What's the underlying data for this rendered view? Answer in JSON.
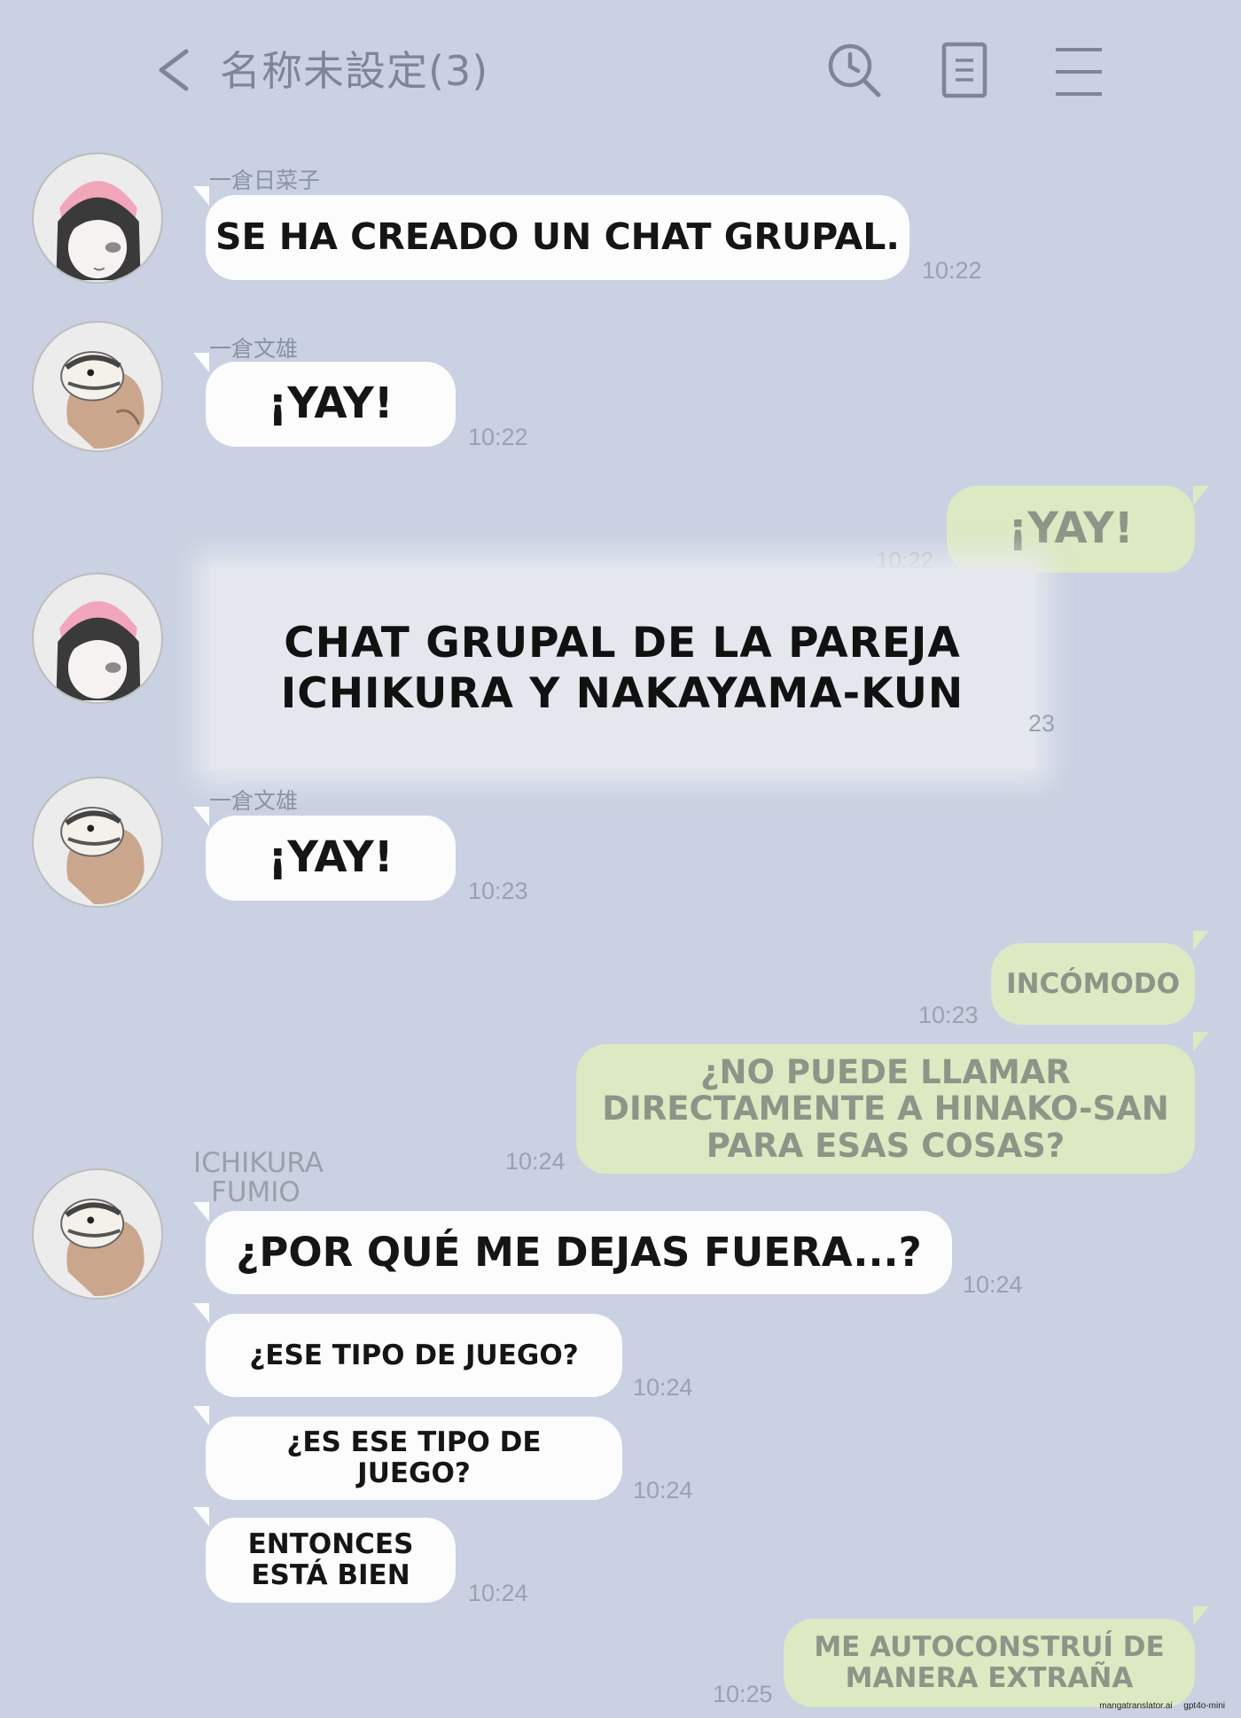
{
  "header": {
    "title": "名称未設定(3)",
    "icons": [
      "back-chevron-icon",
      "clock-search-icon",
      "notes-icon",
      "menu-icon"
    ]
  },
  "colors": {
    "background": "#c9d1e2",
    "incoming_bubble": "#fcfcfc",
    "outgoing_bubble": "#dce9c2",
    "avatar_band": "#f2a6bb"
  },
  "messages": [
    {
      "sender": "一倉日菜子",
      "text": "SE HA CREADO UN CHAT GRUPAL.",
      "time": "10:22"
    },
    {
      "sender": "一倉文雄",
      "text": "¡YAY!",
      "time": "10:22"
    },
    {
      "sender": "",
      "text": "¡YAY!",
      "time": "10:22"
    },
    {
      "sender": "",
      "text_lines": [
        "CHAT GRUPAL DE LA PAREJA",
        "ICHIKURA Y NAKAYAMA-KUN"
      ],
      "time": "23"
    },
    {
      "sender": "一倉文雄",
      "text": "¡YAY!",
      "time": "10:23"
    },
    {
      "sender": "",
      "text": "INCÓMODO",
      "time": "10:23"
    },
    {
      "sender": "",
      "text_lines": [
        "¿NO PUEDE LLAMAR",
        "DIRECTAMENTE A HINAKO-SAN",
        "PARA ESAS COSAS?"
      ],
      "time": "10:24"
    },
    {
      "sender_lines": [
        "ICHIKURA",
        "FUMIO"
      ],
      "text": "¿POR QUÉ ME DEJAS FUERA...?",
      "time": "10:24"
    },
    {
      "sender": "",
      "text": "¿ESE TIPO DE JUEGO?",
      "time": "10:24"
    },
    {
      "sender": "",
      "text_lines": [
        "¿ES ESE TIPO DE",
        "JUEGO?"
      ],
      "time": "10:24"
    },
    {
      "sender": "",
      "text_lines": [
        "ENTONCES",
        "ESTÁ BIEN"
      ],
      "time": "10:24"
    },
    {
      "sender": "",
      "text_lines": [
        "ME AUTOCONSTRUÍ DE",
        "MANERA EXTRAÑA"
      ],
      "time": "10:25"
    }
  ],
  "watermark": [
    "mangatranslator.ai",
    "gpt4o-mini"
  ]
}
